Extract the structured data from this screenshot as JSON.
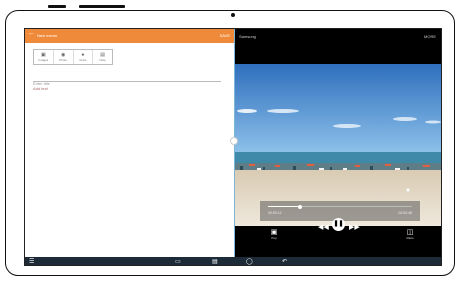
{
  "left_app": {
    "back_icon": "arrow-left-icon",
    "title": "New memo",
    "action": "SAVE",
    "tools": [
      {
        "icon": "image-icon",
        "label": "Images"
      },
      {
        "icon": "camera-icon",
        "label": "Photo"
      },
      {
        "icon": "mic-icon",
        "label": "Voice"
      },
      {
        "icon": "document-icon",
        "label": "Note"
      }
    ],
    "title_placeholder": "Enter title",
    "add_text": "Add text",
    "accent_color": "#ef8a3a"
  },
  "video_app": {
    "title": "Samsung",
    "action": "MORE",
    "progress_fraction": 0.22,
    "elapsed": "00:00:12",
    "total": "00:02:48",
    "controls": [
      {
        "icon": "popup-icon",
        "label": "Pop"
      },
      {
        "icon": "rewind-icon",
        "label": ""
      },
      {
        "icon": "pause-icon",
        "label": ""
      },
      {
        "icon": "fast-forward-icon",
        "label": ""
      },
      {
        "icon": "screen-mode-icon",
        "label": "Ratio"
      }
    ]
  },
  "navbar": {
    "icons": [
      "settings-icon",
      "recent-apps-icon",
      "multiwindow-icon",
      "home-icon",
      "back-icon"
    ],
    "color": "#1d2b38"
  }
}
